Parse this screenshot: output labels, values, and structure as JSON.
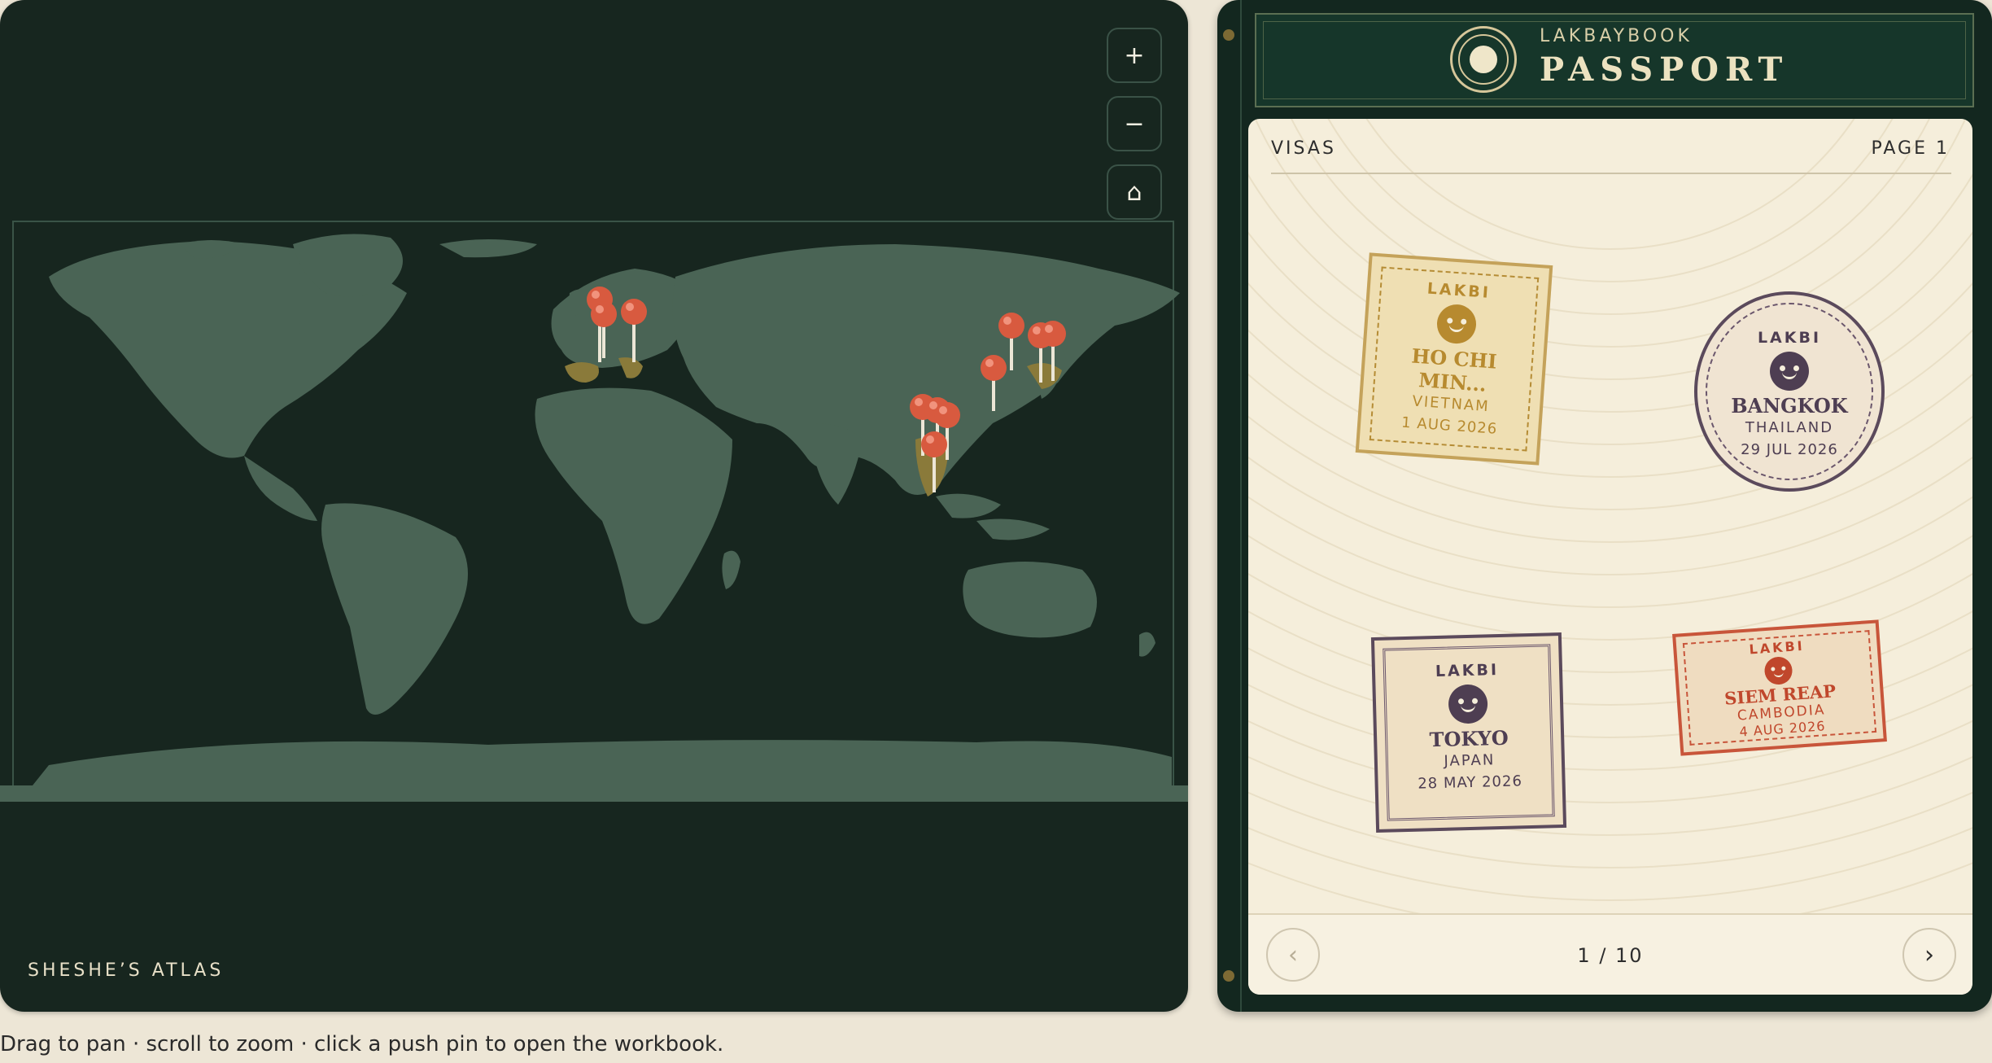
{
  "map": {
    "title": "SHESHE’S ATLAS",
    "zoom_in_label": "+",
    "zoom_out_label": "−",
    "home_label": "⌂",
    "hint": "Drag to pan · scroll to zoom · click a push pin to open the workbook."
  },
  "passport": {
    "brand": "LAKBAYBOOK",
    "title": "PASSPORT",
    "section_label": "VISAS",
    "page_label": "PAGE 1",
    "page_count": "1 / 10",
    "prev_label": "‹",
    "next_label": "›",
    "stamps": [
      {
        "label": "LAKBI",
        "city": "HO CHI MIN...",
        "country": "VIETNAM",
        "date": "1 AUG 2026"
      },
      {
        "label": "LAKBI",
        "city": "BANGKOK",
        "country": "THAILAND",
        "date": "29 JUL 2026"
      },
      {
        "label": "LAKBI",
        "city": "TOKYO",
        "country": "JAPAN",
        "date": "28 MAY 2026"
      },
      {
        "label": "LAKBI",
        "city": "SIEM REAP",
        "country": "CAMBODIA",
        "date": "4 AUG 2026"
      }
    ]
  },
  "colors": {
    "map_bg": "#17261f",
    "land": "#4a6455",
    "highlight_land": "#8a7a3a",
    "pin": "#d85a3f",
    "passport_cover": "#13271f",
    "page": "#f5eedb"
  }
}
